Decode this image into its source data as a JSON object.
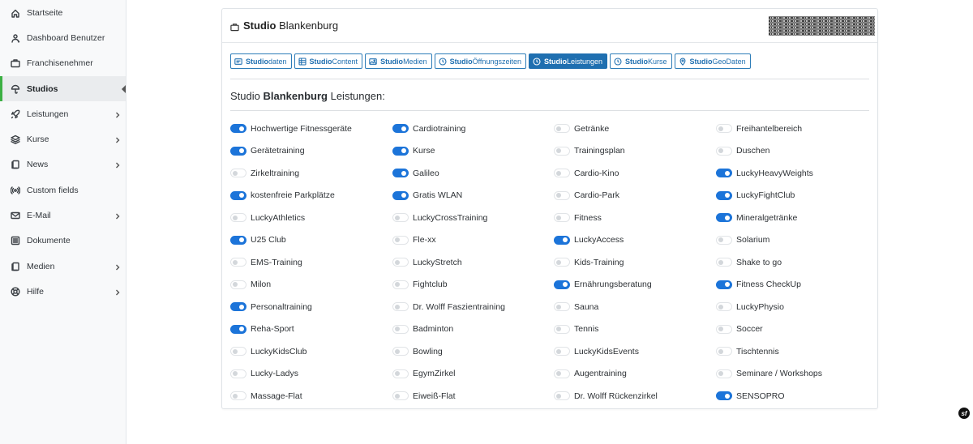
{
  "sidebar": {
    "items": [
      {
        "label": "Startseite",
        "icon": "home-icon",
        "has_children": false,
        "active": false
      },
      {
        "label": "Dashboard Benutzer",
        "icon": "user-icon",
        "has_children": false,
        "active": false
      },
      {
        "label": "Franchisenehmer",
        "icon": "briefcase-icon",
        "has_children": false,
        "active": false
      },
      {
        "label": "Studios",
        "icon": "umbrella-icon",
        "has_children": true,
        "active": true
      },
      {
        "label": "Leistungen",
        "icon": "rocket-icon",
        "has_children": true,
        "active": false
      },
      {
        "label": "Kurse",
        "icon": "layers-icon",
        "has_children": true,
        "active": false
      },
      {
        "label": "News",
        "icon": "copy-icon",
        "has_children": true,
        "active": false
      },
      {
        "label": "Custom fields",
        "icon": "broadcast-icon",
        "has_children": false,
        "active": false
      },
      {
        "label": "E-Mail",
        "icon": "envelope-icon",
        "has_children": true,
        "active": false
      },
      {
        "label": "Dokumente",
        "icon": "document-list-icon",
        "has_children": false,
        "active": false
      },
      {
        "label": "Medien",
        "icon": "copy-icon",
        "has_children": true,
        "active": false
      },
      {
        "label": "Hilfe",
        "icon": "lifebuoy-icon",
        "has_children": true,
        "active": false
      }
    ]
  },
  "card": {
    "title_bold": "Studio",
    "title_rest": "Blankenburg",
    "qr_code": "qr-code-image"
  },
  "tabs": [
    {
      "bold": "Studio",
      "rest": "daten",
      "icon": "id-card-icon",
      "active": false
    },
    {
      "bold": "Studio",
      "rest": "Content",
      "icon": "grid-icon",
      "active": false
    },
    {
      "bold": "Studio",
      "rest": "Medien",
      "icon": "image-icon",
      "active": false
    },
    {
      "bold": "Studio",
      "rest": "Öffnungszeiten",
      "icon": "clock-icon",
      "active": false
    },
    {
      "bold": "Studio",
      "rest": "Leistungen",
      "icon": "clock-icon",
      "active": true
    },
    {
      "bold": "Studio",
      "rest": "Kurse",
      "icon": "clock-icon",
      "active": false
    },
    {
      "bold": "Studio",
      "rest": "GeoDaten",
      "icon": "map-pin-icon",
      "active": false
    }
  ],
  "section": {
    "prefix": "Studio",
    "name": "Blankenburg",
    "suffix": "Leistungen:"
  },
  "colors": {
    "toggle_on": "#1c74d9",
    "tab_accent": "#1f6fb0",
    "sidebar_active_marker": "#3cb043"
  },
  "services": [
    [
      {
        "label": "Hochwertige Fitnessgeräte",
        "on": true
      },
      {
        "label": "Gerätetraining",
        "on": true
      },
      {
        "label": "Zirkeltraining",
        "on": false
      },
      {
        "label": "kostenfreie Parkplätze",
        "on": true
      },
      {
        "label": "LuckyAthletics",
        "on": false
      },
      {
        "label": "U25 Club",
        "on": true
      },
      {
        "label": "EMS-Training",
        "on": false
      },
      {
        "label": "Milon",
        "on": false
      },
      {
        "label": "Personaltraining",
        "on": true
      },
      {
        "label": "Reha-Sport",
        "on": true
      },
      {
        "label": "LuckyKidsClub",
        "on": false
      },
      {
        "label": "Lucky-Ladys",
        "on": false
      },
      {
        "label": "Massage-Flat",
        "on": false
      }
    ],
    [
      {
        "label": "Cardiotraining",
        "on": true
      },
      {
        "label": "Kurse",
        "on": true
      },
      {
        "label": "Galileo",
        "on": true
      },
      {
        "label": "Gratis WLAN",
        "on": true
      },
      {
        "label": "LuckyCrossTraining",
        "on": false
      },
      {
        "label": "Fle-xx",
        "on": false
      },
      {
        "label": "LuckyStretch",
        "on": false
      },
      {
        "label": "Fightclub",
        "on": false
      },
      {
        "label": "Dr. Wolff Faszientraining",
        "on": false
      },
      {
        "label": "Badminton",
        "on": false
      },
      {
        "label": "Bowling",
        "on": false
      },
      {
        "label": "EgymZirkel",
        "on": false
      },
      {
        "label": "Eiweiß-Flat",
        "on": false
      }
    ],
    [
      {
        "label": "Getränke",
        "on": false
      },
      {
        "label": "Trainingsplan",
        "on": false
      },
      {
        "label": "Cardio-Kino",
        "on": false
      },
      {
        "label": "Cardio-Park",
        "on": false
      },
      {
        "label": "Fitness",
        "on": false
      },
      {
        "label": "LuckyAccess",
        "on": true
      },
      {
        "label": "Kids-Training",
        "on": false
      },
      {
        "label": "Ernährungsberatung",
        "on": true
      },
      {
        "label": "Sauna",
        "on": false
      },
      {
        "label": "Tennis",
        "on": false
      },
      {
        "label": "LuckyKidsEvents",
        "on": false
      },
      {
        "label": "Augentraining",
        "on": false
      },
      {
        "label": "Dr. Wolff Rückenzirkel",
        "on": false
      }
    ],
    [
      {
        "label": "Freihantelbereich",
        "on": false
      },
      {
        "label": "Duschen",
        "on": false
      },
      {
        "label": "LuckyHeavyWeights",
        "on": true
      },
      {
        "label": "LuckyFightClub",
        "on": true
      },
      {
        "label": "Mineralgetränke",
        "on": true
      },
      {
        "label": "Solarium",
        "on": false
      },
      {
        "label": "Shake to go",
        "on": false
      },
      {
        "label": "Fitness CheckUp",
        "on": true
      },
      {
        "label": "LuckyPhysio",
        "on": false
      },
      {
        "label": "Soccer",
        "on": false
      },
      {
        "label": "Tischtennis",
        "on": false
      },
      {
        "label": "Seminare / Workshops",
        "on": false
      },
      {
        "label": "SENSOPRO",
        "on": true
      }
    ]
  ],
  "footer": {
    "badge_text": "sf"
  }
}
